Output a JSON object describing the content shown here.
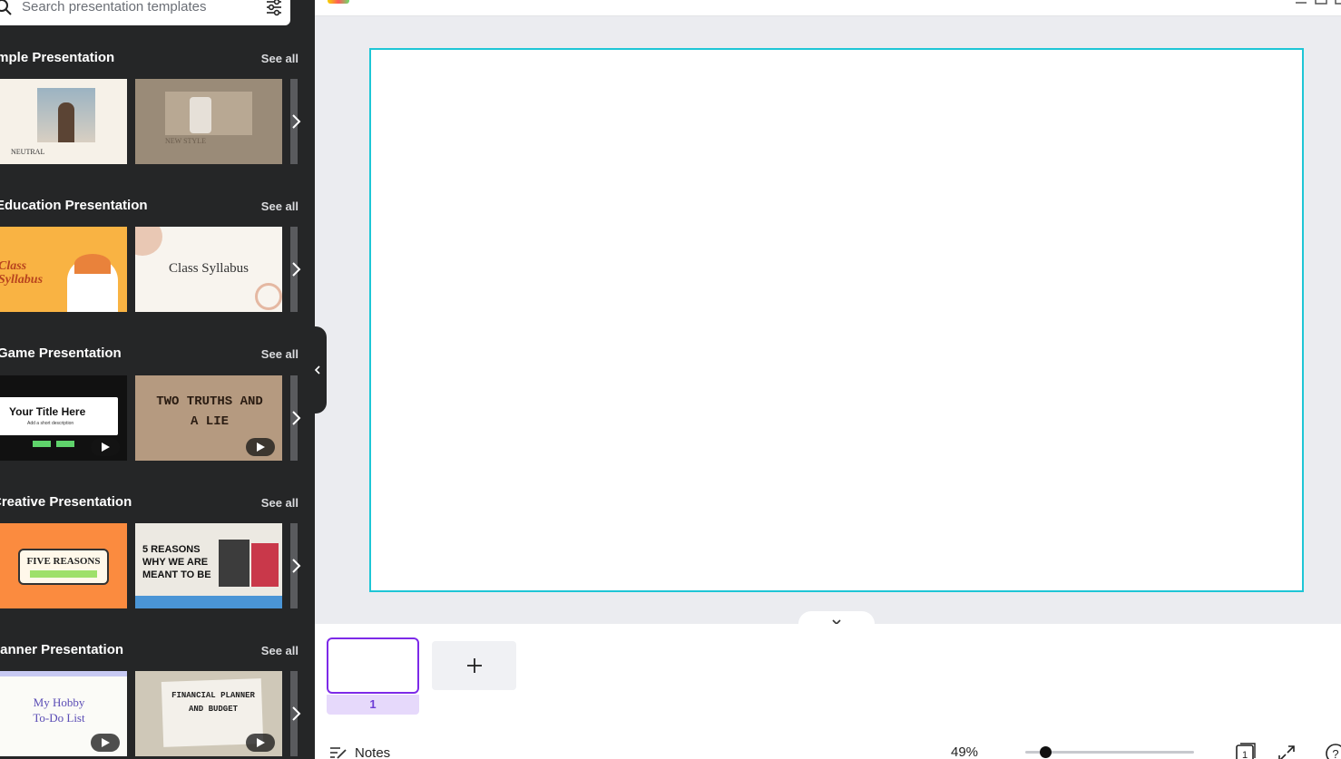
{
  "search": {
    "placeholder": "Search presentation templates"
  },
  "sections": [
    {
      "title": "Simple Presentation",
      "see_all": "See all",
      "templates": [
        {
          "label": "NEUTRAL"
        },
        {
          "label": "NEW STYLE"
        }
      ]
    },
    {
      "title": "Education Presentation",
      "see_all": "See all",
      "templates": [
        {
          "label": "Class Syllabus"
        },
        {
          "label": "Class Syllabus"
        }
      ]
    },
    {
      "title": "Game Presentation",
      "see_all": "See all",
      "templates": [
        {
          "label": "Your Title Here",
          "sub": "Add a short description"
        },
        {
          "label": "TWO TRUTHS AND A LIE"
        }
      ]
    },
    {
      "title": "Creative Presentation",
      "see_all": "See all",
      "templates": [
        {
          "label": "FIVE REASONS"
        },
        {
          "label": "5 REASONS WHY WE ARE MEANT TO BE"
        }
      ]
    },
    {
      "title": "Planner Presentation",
      "see_all": "See all",
      "templates": [
        {
          "label": "My Hobby To-Do List"
        },
        {
          "label": "FINANCIAL PLANNER AND BUDGET"
        }
      ]
    }
  ],
  "pages": {
    "current_number": "1",
    "add_label": "+"
  },
  "footer": {
    "notes_label": "Notes",
    "zoom": "49%",
    "zoom_level_percent": 49,
    "page_count": "1"
  },
  "colors": {
    "panel": "#252627",
    "selection": "#1ec6d6",
    "accent": "#7d2ae8"
  }
}
